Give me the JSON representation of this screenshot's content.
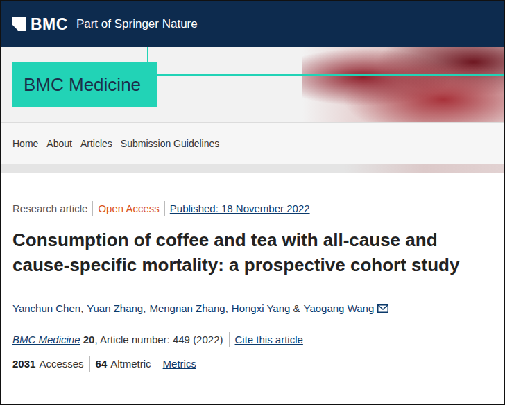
{
  "header": {
    "logo": "BMC",
    "tagline": "Part of Springer Nature"
  },
  "journal": {
    "title": "BMC Medicine"
  },
  "nav": [
    {
      "label": "Home",
      "selected": false
    },
    {
      "label": "About",
      "selected": false
    },
    {
      "label": "Articles",
      "selected": true
    },
    {
      "label": "Submission Guidelines",
      "selected": false
    }
  ],
  "article": {
    "meta": [
      {
        "label": "Research article",
        "kind": "type",
        "color": "#555555"
      },
      {
        "label": "Open Access",
        "kind": "access",
        "color": "#d9541e"
      },
      {
        "label": "Published: 18 November 2022",
        "kind": "date",
        "color": "#0c3a6b"
      }
    ],
    "title": "Consumption of coffee and tea with all-cause and cause-specific mortality: a prospective cohort study",
    "authors": [
      {
        "name": "Yanchun Chen",
        "after": ",",
        "corresponding": false
      },
      {
        "name": "Yuan Zhang",
        "after": ",",
        "corresponding": false
      },
      {
        "name": "Mengnan Zhang",
        "after": ",",
        "corresponding": false
      },
      {
        "name": "Hongxi Yang",
        "after": " &",
        "corresponding": false
      },
      {
        "name": "Yaogang Wang",
        "after": "",
        "corresponding": true
      }
    ],
    "citation": {
      "journal": "BMC Medicine",
      "volume": "20",
      "details": ", Article number: 449 (2022)",
      "cite": "Cite this article"
    },
    "metrics": [
      {
        "value": "2031",
        "label": "Accesses",
        "kind": "count"
      },
      {
        "value": "64",
        "label": "Altmetric",
        "kind": "count"
      },
      {
        "value": "",
        "label": "Metrics",
        "kind": "link"
      }
    ]
  }
}
